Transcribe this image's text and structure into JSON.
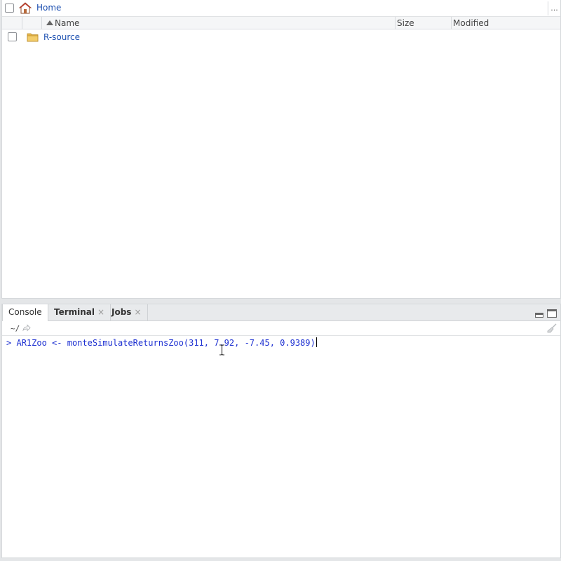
{
  "files": {
    "breadcrumb": {
      "home_label": "Home"
    },
    "more_label": "...",
    "columns": {
      "name": "Name",
      "size": "Size",
      "modified": "Modified"
    },
    "rows": [
      {
        "name": "R-source",
        "size": "",
        "modified": "",
        "type": "folder"
      }
    ]
  },
  "console": {
    "tabs": [
      {
        "label": "Console",
        "active": true,
        "closable": false
      },
      {
        "label": "Terminal",
        "active": false,
        "closable": true
      },
      {
        "label": "Jobs",
        "active": false,
        "closable": true
      }
    ],
    "close_glyph": "×",
    "working_dir": "~/",
    "prompt": ">",
    "input": "AR1Zoo <- monteSimulateReturnsZoo(311, 7.92, -7.45, 0.9389)"
  },
  "colors": {
    "link": "#1c4fb0",
    "console_text": "#1c2fd1",
    "home_roof": "#c0392b",
    "folder": "#e8b84a"
  },
  "icons": [
    "home-icon",
    "folder-icon",
    "minimize-icon",
    "maximize-icon",
    "goto-dir-icon",
    "broom-icon",
    "sort-asc-icon",
    "text-cursor-icon"
  ]
}
